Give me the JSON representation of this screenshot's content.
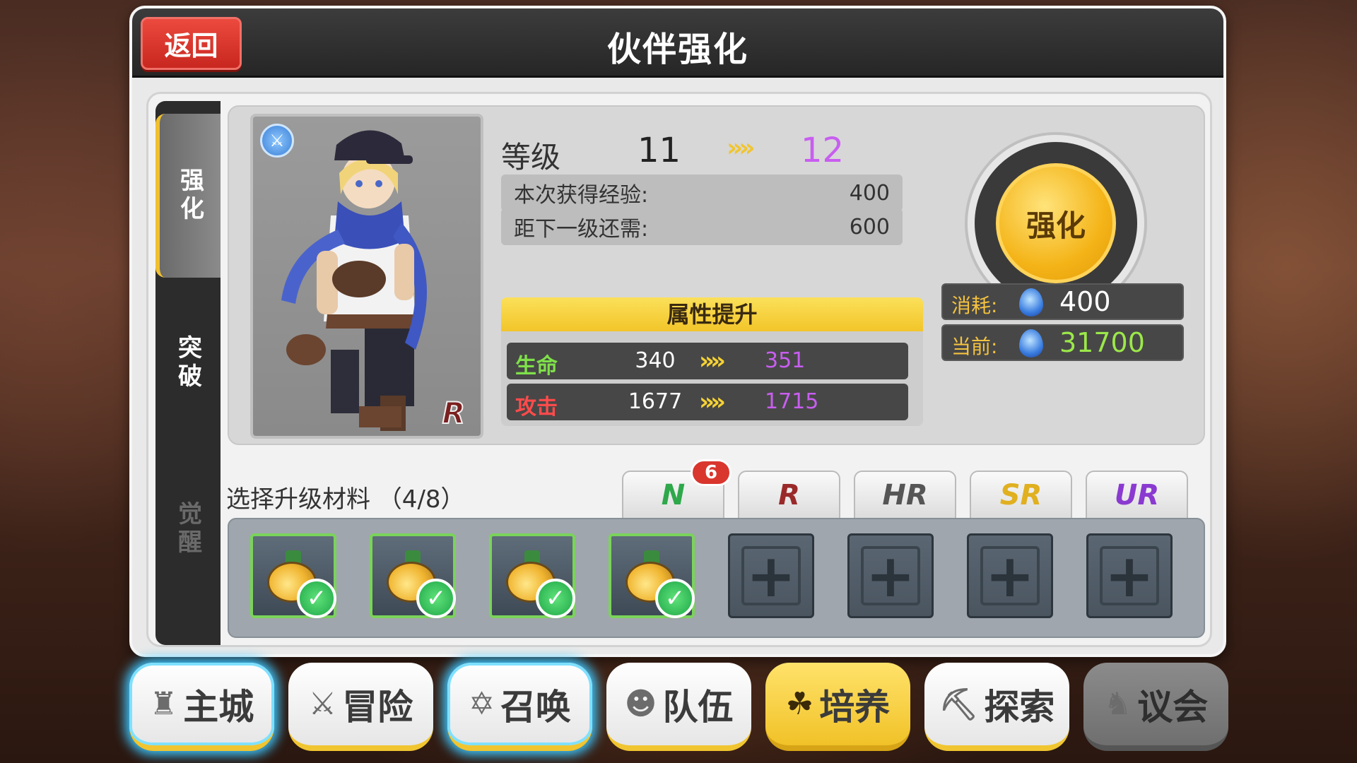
{
  "header": {
    "back_label": "返回",
    "title": "伙伴强化"
  },
  "side_tabs": [
    {
      "label": "强化",
      "state": "active"
    },
    {
      "label": "突破",
      "state": "normal"
    },
    {
      "label": "觉醒",
      "state": "disabled"
    }
  ],
  "character": {
    "rarity": "R",
    "weapon_icon": "sword-icon"
  },
  "level": {
    "label": "等级",
    "current": "11",
    "next": "12",
    "arrow": "»"
  },
  "exp": {
    "gain_label": "本次获得经验:",
    "gain_value": "400",
    "need_label": "距下一级还需:",
    "need_value": "600"
  },
  "attributes": {
    "title": "属性提升",
    "rows": [
      {
        "name": "生命",
        "current": "340",
        "next": "351",
        "name_color": "#7fe04a"
      },
      {
        "name": "攻击",
        "current": "1677",
        "next": "1715",
        "name_color": "#ff4b4b"
      }
    ]
  },
  "enhance": {
    "label": "强化"
  },
  "cost": {
    "consume_label": "消耗:",
    "consume_value": "400",
    "current_label": "当前:",
    "current_value": "31700"
  },
  "materials": {
    "label": "选择升级材料  （4/8）",
    "filled_count": 4,
    "total": 8
  },
  "rarity_tabs": [
    {
      "label": "N",
      "color": "#2ea84a",
      "badge": "6"
    },
    {
      "label": "R",
      "color": "#9a2a2a"
    },
    {
      "label": "HR",
      "color": "#555555"
    },
    {
      "label": "SR",
      "color": "#e0b020"
    },
    {
      "label": "UR",
      "color": "#8a3ad0"
    }
  ],
  "nav": [
    {
      "label": "主城",
      "icon": "castle-icon"
    },
    {
      "label": "冒险",
      "icon": "crossed-swords-icon"
    },
    {
      "label": "召唤",
      "icon": "summon-circle-icon"
    },
    {
      "label": "队伍",
      "icon": "team-icon"
    },
    {
      "label": "培养",
      "icon": "cultivate-icon"
    },
    {
      "label": "探索",
      "icon": "explore-icon"
    },
    {
      "label": "议会",
      "icon": "council-icon"
    }
  ]
}
